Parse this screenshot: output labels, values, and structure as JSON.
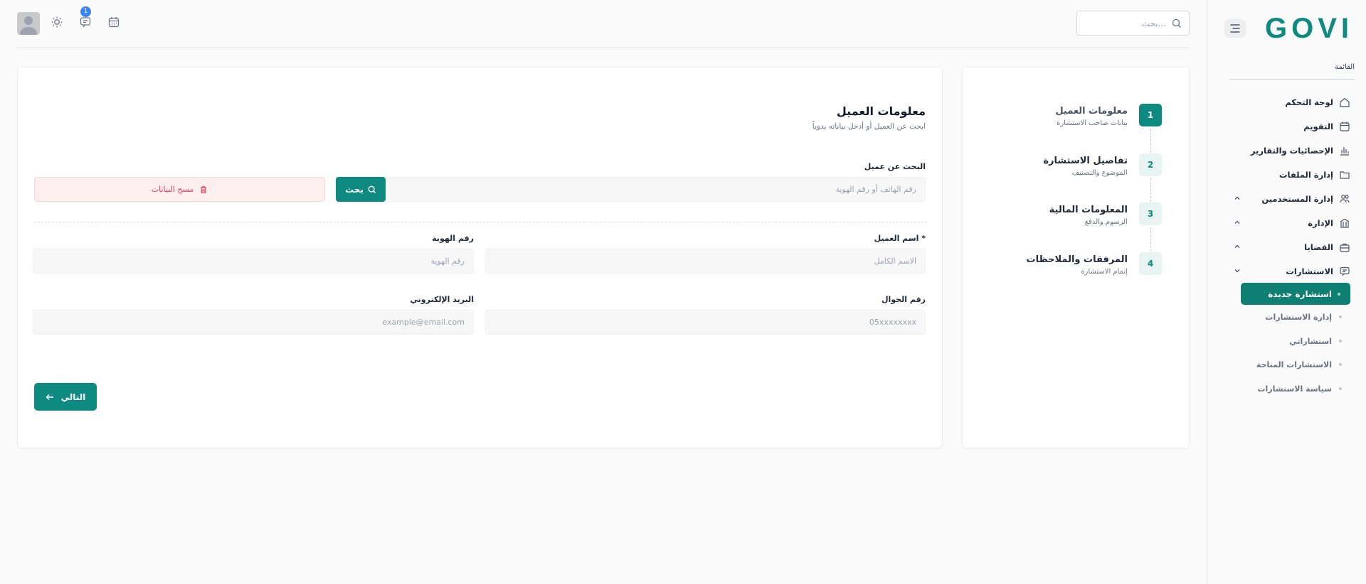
{
  "brand": {
    "logo_text": "GOVI",
    "accent": "#0f8a80"
  },
  "header": {
    "search_placeholder": "بحث...",
    "notification_count": "1"
  },
  "sidebar": {
    "menu_label": "القائمة",
    "items": [
      {
        "label": "لوحة التحكم",
        "icon": "home-icon"
      },
      {
        "label": "التقويم",
        "icon": "calendar-icon"
      },
      {
        "label": "الإحصائيات والتقارير",
        "icon": "chart-icon"
      },
      {
        "label": "إدارة الملفات",
        "icon": "folder-icon"
      },
      {
        "label": "إدارة المستخدمين",
        "icon": "users-icon",
        "expand": "collapsed"
      },
      {
        "label": "الإدارة",
        "icon": "building-icon",
        "expand": "collapsed"
      },
      {
        "label": "القضايا",
        "icon": "briefcase-icon",
        "expand": "collapsed"
      },
      {
        "label": "الاستشارات",
        "icon": "chat-icon",
        "expand": "expanded"
      }
    ],
    "active_sub": "استشارة جديدة",
    "sub_items": [
      "إدارة الاستشارات",
      "استشاراتي",
      "الاستشارات المتاحة",
      "سياسة الاستشارات"
    ]
  },
  "stepper": [
    {
      "number": "1",
      "title": "معلومات العميل",
      "subtitle": "بيانات صاحب الاستشارة",
      "active": true
    },
    {
      "number": "2",
      "title": "تفاصيل الاستشارة",
      "subtitle": "الموضوع والتصنيف",
      "active": false
    },
    {
      "number": "3",
      "title": "المعلومات المالية",
      "subtitle": "الرسوم والدفع",
      "active": false
    },
    {
      "number": "4",
      "title": "المرفقات والملاحظات",
      "subtitle": "إتمام الاستشارة",
      "active": false
    }
  ],
  "form": {
    "title": "معلومات العميل",
    "subtitle": "ابحث عن العميل أو أدخل بياناته يدوياً",
    "search_label": "البحث عن عميل",
    "search_placeholder": "رقم الهاتف أو رقم الهوية",
    "search_button": "بحث",
    "clear_button": "مسح البيانات",
    "client_name_label": "اسم العميل *",
    "client_name_placeholder": "الاسم الكامل",
    "id_label": "رقم الهوية",
    "id_placeholder": "رقم الهوية",
    "mobile_label": "رقم الجوال",
    "mobile_placeholder": "05xxxxxxxx",
    "email_label": "البريد الإلكتروني",
    "email_placeholder": "example@email.com",
    "next_button": "التالي"
  }
}
